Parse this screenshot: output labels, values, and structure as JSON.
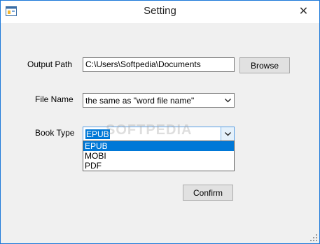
{
  "window": {
    "title": "Setting",
    "close_glyph": "✕",
    "border_color": "#1b78d9"
  },
  "form": {
    "output_path_label": "Output Path",
    "output_path_value": "C:\\Users\\Softpedia\\Documents",
    "browse_label": "Browse",
    "file_name_label": "File Name",
    "file_name_value": "the same as \"word file name\"",
    "book_type_label": "Book Type",
    "book_type_value": "EPUB",
    "book_type_options": [
      "EPUB",
      "MOBI",
      "PDF"
    ],
    "confirm_label": "Confirm"
  },
  "watermark": "SOFTPEDIA",
  "icons": {
    "app": "app-form-icon",
    "close": "close-icon",
    "dropdown": "chevron-down-icon",
    "grip": "resize-grip-icon"
  },
  "colors": {
    "selection": "#0078d7",
    "button_face": "#e1e1e1",
    "background": "#f0f0f0"
  }
}
